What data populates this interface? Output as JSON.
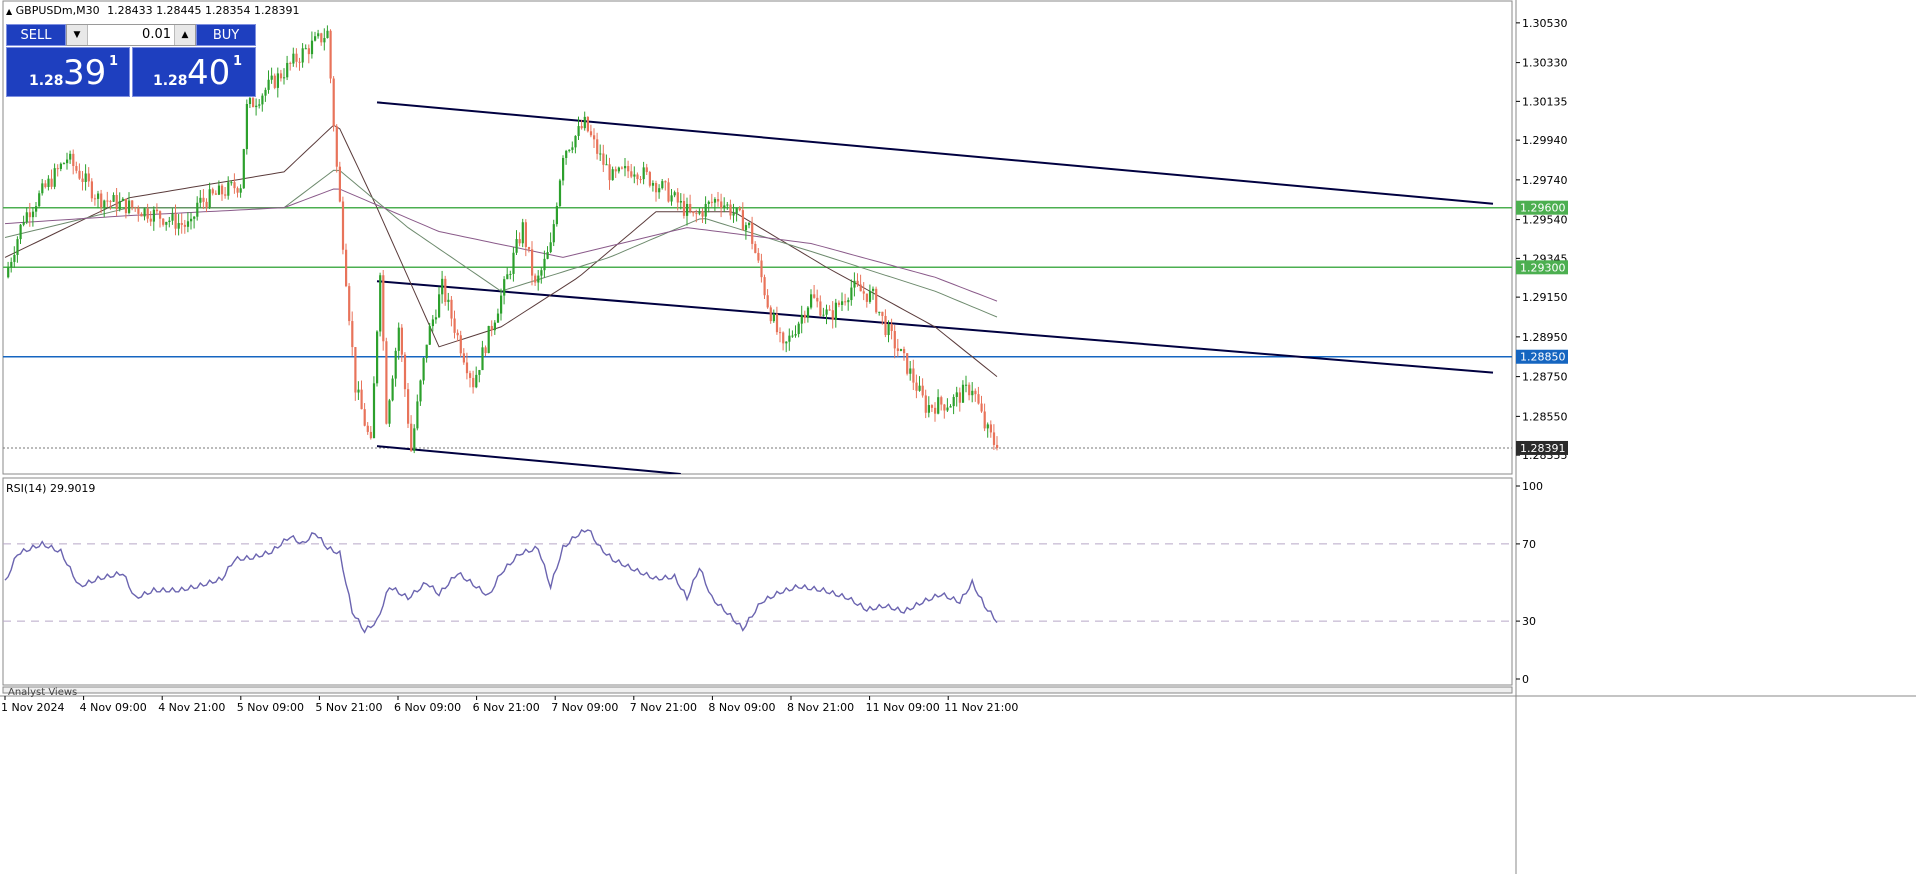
{
  "header": {
    "symbol_label": "GBPUSDm,M30",
    "ohlc_label": "1.28433 1.28445 1.28354 1.28391"
  },
  "trade_panel": {
    "sell_label": "SELL",
    "buy_label": "BUY",
    "lot_value": "0.01",
    "sell_quote": {
      "prefix": "1.28",
      "big": "39",
      "sup": "1"
    },
    "buy_quote": {
      "prefix": "1.28",
      "big": "40",
      "sup": "1"
    }
  },
  "colors": {
    "bull_candle": "#2ca02c",
    "bear_candle": "#e8735a",
    "trendline": "#000040",
    "resistance_line": "#4caf50",
    "pivot_line": "#1565c0",
    "current_price_box": "#2b2b2b",
    "rsi_line": "#6b64b0",
    "ma_fast": "#5a3b3b",
    "ma_mid": "#6d8a6d",
    "ma_slow": "#8a5a8a"
  },
  "chart_data": [
    {
      "type": "candlestick",
      "timeframe": "M30",
      "x_tick_labels": [
        "1 Nov 2024",
        "4 Nov 09:00",
        "4 Nov 21:00",
        "5 Nov 09:00",
        "5 Nov 21:00",
        "6 Nov 09:00",
        "6 Nov 21:00",
        "7 Nov 09:00",
        "7 Nov 21:00",
        "8 Nov 09:00",
        "8 Nov 21:00",
        "11 Nov 09:00",
        "11 Nov 21:00"
      ],
      "y_tick_labels": [
        "1.30530",
        "1.30330",
        "1.30135",
        "1.29940",
        "1.29740",
        "1.29540",
        "1.29345",
        "1.29150",
        "1.28950",
        "1.28750",
        "1.28550",
        "1.28355"
      ],
      "ylim": [
        1.2826,
        1.3064
      ],
      "close_path": [
        [
          0,
          1.2925
        ],
        [
          6,
          1.2955
        ],
        [
          20,
          1.2985
        ],
        [
          30,
          1.2965
        ],
        [
          46,
          1.2958
        ],
        [
          60,
          1.295
        ],
        [
          62,
          1.2962
        ],
        [
          76,
          1.2972
        ],
        [
          78,
          1.301
        ],
        [
          96,
          1.3038
        ],
        [
          104,
          1.3048
        ],
        [
          107,
          1.298
        ],
        [
          113,
          1.287
        ],
        [
          118,
          1.284
        ],
        [
          121,
          1.293
        ],
        [
          123,
          1.2855
        ],
        [
          127,
          1.29
        ],
        [
          131,
          1.2838
        ],
        [
          136,
          1.2893
        ],
        [
          141,
          1.292
        ],
        [
          146,
          1.2895
        ],
        [
          151,
          1.2872
        ],
        [
          161,
          1.292
        ],
        [
          167,
          1.295
        ],
        [
          171,
          1.292
        ],
        [
          176,
          1.294
        ],
        [
          180,
          1.2988
        ],
        [
          187,
          1.3002
        ],
        [
          192,
          1.2985
        ],
        [
          196,
          1.2975
        ],
        [
          203,
          1.298
        ],
        [
          212,
          1.297
        ],
        [
          222,
          1.2955
        ],
        [
          230,
          1.2965
        ],
        [
          240,
          1.295
        ],
        [
          246,
          1.2912
        ],
        [
          251,
          1.2888
        ],
        [
          260,
          1.2915
        ],
        [
          266,
          1.2905
        ],
        [
          273,
          1.292
        ],
        [
          280,
          1.2915
        ],
        [
          284,
          1.29
        ],
        [
          291,
          1.288
        ],
        [
          297,
          1.286
        ],
        [
          305,
          1.2862
        ],
        [
          312,
          1.287
        ],
        [
          316,
          1.285
        ],
        [
          320,
          1.28391
        ]
      ],
      "moving_averages": [
        {
          "color_key": "ma_fast",
          "values": [
            [
              0,
              1.2935
            ],
            [
              40,
              1.2965
            ],
            [
              90,
              1.2978
            ],
            [
              107,
              1.3003
            ],
            [
              120,
              1.296
            ],
            [
              140,
              1.289
            ],
            [
              160,
              1.29
            ],
            [
              185,
              1.2925
            ],
            [
              210,
              1.2958
            ],
            [
              235,
              1.2958
            ],
            [
              265,
              1.293
            ],
            [
              300,
              1.29
            ],
            [
              320,
              1.2875
            ]
          ]
        },
        {
          "color_key": "ma_mid",
          "values": [
            [
              0,
              1.2945
            ],
            [
              40,
              1.296
            ],
            [
              90,
              1.296
            ],
            [
              107,
              1.298
            ],
            [
              130,
              1.295
            ],
            [
              160,
              1.2918
            ],
            [
              195,
              1.2935
            ],
            [
              225,
              1.2955
            ],
            [
              260,
              1.2938
            ],
            [
              300,
              1.2918
            ],
            [
              320,
              1.2905
            ]
          ]
        },
        {
          "color_key": "ma_slow",
          "values": [
            [
              0,
              1.2952
            ],
            [
              40,
              1.2956
            ],
            [
              90,
              1.296
            ],
            [
              107,
              1.297
            ],
            [
              140,
              1.2948
            ],
            [
              180,
              1.2935
            ],
            [
              220,
              1.295
            ],
            [
              260,
              1.2942
            ],
            [
              300,
              1.2925
            ],
            [
              320,
              1.2913
            ]
          ]
        }
      ],
      "horizontal_levels": [
        {
          "price": 1.296,
          "label": "1.29600",
          "color_key": "resistance_line"
        },
        {
          "price": 1.293,
          "label": "1.29300",
          "color_key": "resistance_line"
        },
        {
          "price": 1.2885,
          "label": "1.28850",
          "color_key": "pivot_line"
        }
      ],
      "current_price": {
        "price": 1.28391,
        "label": "1.28391"
      },
      "trendlines": [
        {
          "x0": 120,
          "y0": 1.3013,
          "x1": 480,
          "y1": 1.2962
        },
        {
          "x0": 120,
          "y0": 1.2923,
          "x1": 480,
          "y1": 1.2877
        },
        {
          "x0": 120,
          "y0": 1.284,
          "x1": 218,
          "y1": 1.2826
        }
      ]
    },
    {
      "type": "line",
      "indicator_label": "RSI(14) 29.9019",
      "y_tick_labels": [
        "100",
        "70",
        "30",
        "0"
      ],
      "ylim": [
        0,
        100
      ],
      "reference_levels": [
        70,
        30
      ],
      "values_path": [
        [
          0,
          50
        ],
        [
          4,
          65
        ],
        [
          12,
          70
        ],
        [
          18,
          66
        ],
        [
          24,
          48
        ],
        [
          30,
          52
        ],
        [
          38,
          55
        ],
        [
          42,
          42
        ],
        [
          48,
          46
        ],
        [
          56,
          46
        ],
        [
          62,
          48
        ],
        [
          70,
          52
        ],
        [
          74,
          62
        ],
        [
          80,
          63
        ],
        [
          86,
          66
        ],
        [
          92,
          74
        ],
        [
          96,
          70
        ],
        [
          100,
          76
        ],
        [
          104,
          68
        ],
        [
          108,
          65
        ],
        [
          112,
          35
        ],
        [
          116,
          25
        ],
        [
          120,
          30
        ],
        [
          124,
          48
        ],
        [
          130,
          42
        ],
        [
          136,
          50
        ],
        [
          140,
          44
        ],
        [
          146,
          55
        ],
        [
          152,
          48
        ],
        [
          156,
          43
        ],
        [
          160,
          55
        ],
        [
          166,
          65
        ],
        [
          172,
          68
        ],
        [
          176,
          48
        ],
        [
          180,
          68
        ],
        [
          184,
          74
        ],
        [
          188,
          78
        ],
        [
          192,
          68
        ],
        [
          196,
          62
        ],
        [
          204,
          56
        ],
        [
          210,
          52
        ],
        [
          216,
          53
        ],
        [
          220,
          42
        ],
        [
          224,
          58
        ],
        [
          228,
          42
        ],
        [
          232,
          36
        ],
        [
          238,
          26
        ],
        [
          244,
          40
        ],
        [
          250,
          45
        ],
        [
          256,
          48
        ],
        [
          264,
          46
        ],
        [
          272,
          42
        ],
        [
          278,
          36
        ],
        [
          284,
          38
        ],
        [
          290,
          35
        ],
        [
          296,
          40
        ],
        [
          302,
          44
        ],
        [
          308,
          40
        ],
        [
          312,
          50
        ],
        [
          316,
          38
        ],
        [
          320,
          30
        ]
      ]
    }
  ],
  "footer": {
    "tab_label": "Analyst Views"
  }
}
